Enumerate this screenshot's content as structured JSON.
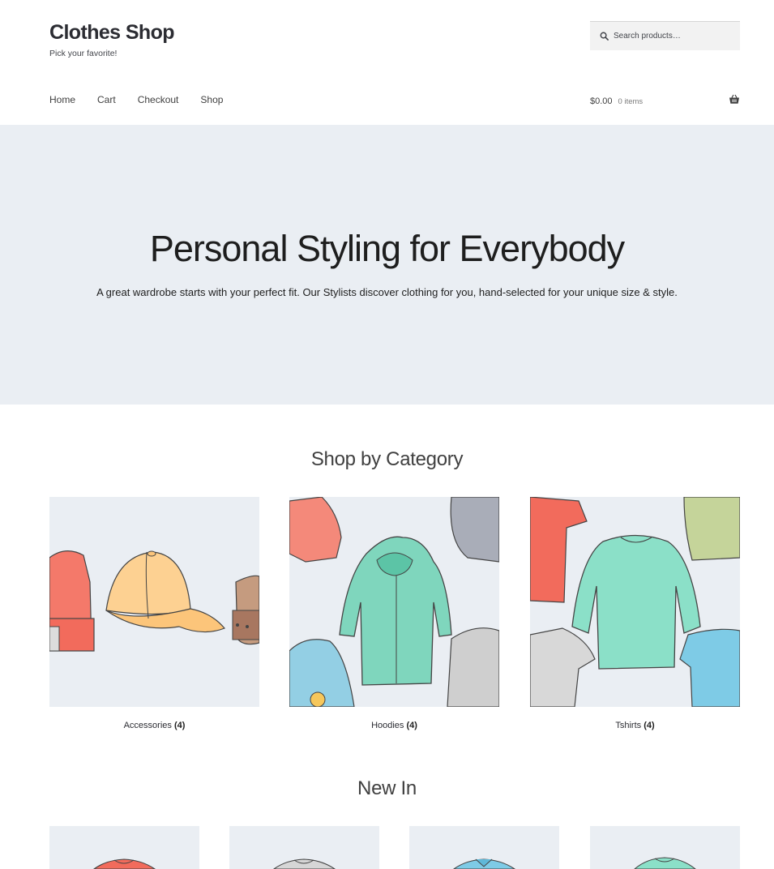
{
  "site": {
    "title": "Clothes Shop",
    "tagline": "Pick your favorite!"
  },
  "search": {
    "placeholder": "Search products…",
    "icon": "search-icon"
  },
  "nav": {
    "items": [
      "Home",
      "Cart",
      "Checkout",
      "Shop"
    ]
  },
  "cart": {
    "amount": "$0.00",
    "count": "0 items",
    "icon": "basket-icon"
  },
  "hero": {
    "title": "Personal Styling for Everybody",
    "text": "A great wardrobe starts with your perfect fit. Our Stylists discover clothing for you, hand-selected for your unique size & style."
  },
  "categories_section": {
    "title": "Shop by Category",
    "items": [
      {
        "name": "Accessories",
        "count": "(4)",
        "image": "accessories-illustration"
      },
      {
        "name": "Hoodies",
        "count": "(4)",
        "image": "hoodies-illustration"
      },
      {
        "name": "Tshirts",
        "count": "(4)",
        "image": "tshirts-illustration"
      }
    ]
  },
  "new_in": {
    "title": "New In",
    "products": [
      {
        "image": "red-tshirt-illustration"
      },
      {
        "image": "grey-tshirt-illustration"
      },
      {
        "image": "blue-polo-illustration"
      },
      {
        "image": "mint-longsleeve-illustration"
      }
    ]
  },
  "colors": {
    "hero_background": "#eaeef3",
    "text": "#404040",
    "title": "#2c2d33"
  }
}
